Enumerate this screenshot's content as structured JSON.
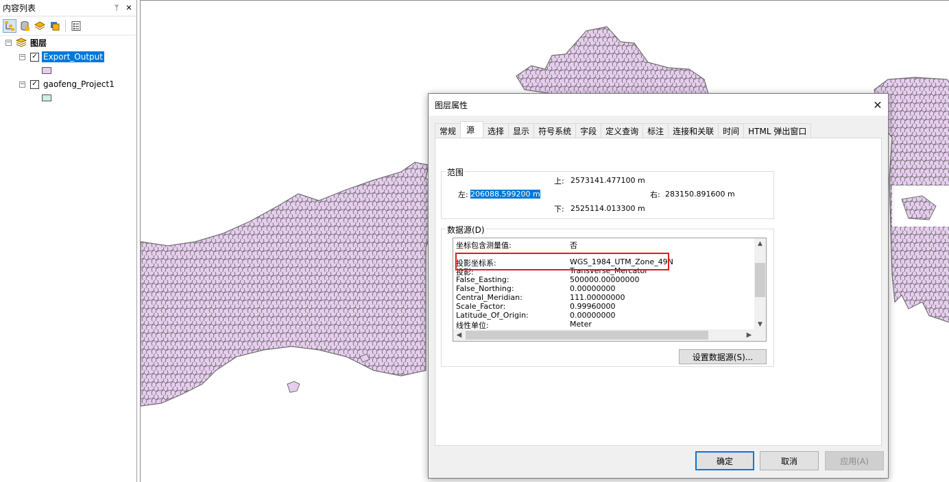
{
  "toc": {
    "title": "内容列表",
    "pin_glyph": "ᛘ",
    "close_glyph": "✕",
    "root_label": "图层",
    "layers": [
      {
        "name": "Export_Output",
        "checked": true,
        "selected": true,
        "symbol_color": "#e6cdee"
      },
      {
        "name": "gaofeng_Project1",
        "checked": true,
        "selected": false,
        "symbol_color": "#cdeee0"
      }
    ],
    "toolbar_icons": [
      "list-by-drawing-order-icon",
      "list-by-source-icon",
      "list-by-visibility-icon",
      "list-by-selection-icon",
      "options-icon"
    ]
  },
  "map": {
    "fill_color": "#e6cdee",
    "outline_color": "#707070"
  },
  "dialog": {
    "title": "图层属性",
    "close_glyph": "✕",
    "tabs": [
      "常规",
      "源",
      "选择",
      "显示",
      "符号系统",
      "字段",
      "定义查询",
      "标注",
      "连接和关联",
      "时间",
      "HTML 弹出窗口"
    ],
    "active_tab": "源",
    "extent": {
      "legend": "范围",
      "top_label": "上:",
      "top_value": "2573141.477100 m",
      "left_label": "左:",
      "left_value": "206088.599200 m",
      "right_label": "右:",
      "right_value": "283150.891600 m",
      "bottom_label": "下:",
      "bottom_value": "2525114.013300 m"
    },
    "datasource": {
      "legend": "数据源(D)",
      "rows": [
        {
          "key": "坐标包含测量值:",
          "value": "否"
        },
        {
          "key": "投影坐标系:",
          "value": "WGS_1984_UTM_Zone_49N"
        },
        {
          "key": "投影:",
          "value": "Transverse_Mercator"
        },
        {
          "key": "False_Easting:",
          "value": "500000.00000000"
        },
        {
          "key": "False_Northing:",
          "value": "0.00000000"
        },
        {
          "key": "Central_Meridian:",
          "value": "111.00000000"
        },
        {
          "key": "Scale_Factor:",
          "value": "0.99960000"
        },
        {
          "key": "Latitude_Of_Origin:",
          "value": "0.00000000"
        },
        {
          "key": "线性单位:",
          "value": "Meter"
        }
      ],
      "set_button": "设置数据源(S)..."
    },
    "buttons": {
      "ok": "确定",
      "cancel": "取消",
      "apply": "应用(A)"
    }
  }
}
